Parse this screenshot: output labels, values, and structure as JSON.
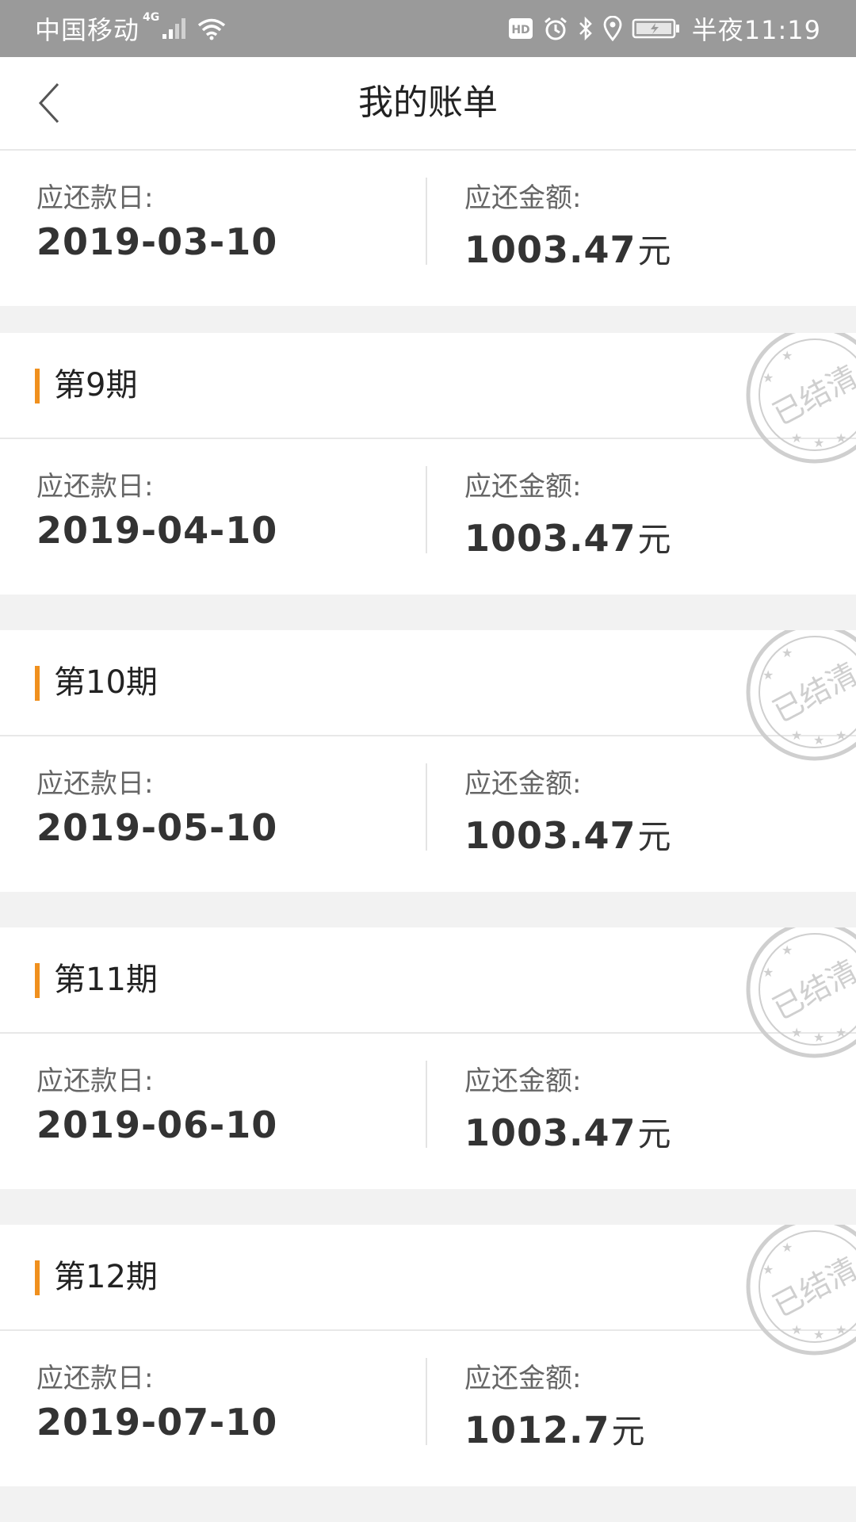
{
  "status_bar": {
    "carrier": "中国移动",
    "network": "4G",
    "time": "半夜11:19",
    "icons": [
      "signal-icon",
      "wifi-icon",
      "hd-icon",
      "alarm-icon",
      "bluetooth-icon",
      "location-icon",
      "battery-icon"
    ]
  },
  "nav": {
    "back_icon": "chevron-left-icon",
    "title": "我的账单"
  },
  "labels": {
    "due_date": "应还款日:",
    "amount": "应还金额:",
    "currency_unit": "元"
  },
  "stamp": {
    "text": "已结清",
    "color": "#cfcfcf"
  },
  "colors": {
    "accent": "#f0901e",
    "status_bar_bg": "#9a9a9a",
    "page_bg": "#f2f2f2"
  },
  "bills": [
    {
      "period": "",
      "due_date": "2019-03-10",
      "amount": "1003.47",
      "settled": false
    },
    {
      "period": "第9期",
      "due_date": "2019-04-10",
      "amount": "1003.47",
      "settled": true
    },
    {
      "period": "第10期",
      "due_date": "2019-05-10",
      "amount": "1003.47",
      "settled": true
    },
    {
      "period": "第11期",
      "due_date": "2019-06-10",
      "amount": "1003.47",
      "settled": true
    },
    {
      "period": "第12期",
      "due_date": "2019-07-10",
      "amount": "1012.7",
      "settled": true
    }
  ]
}
